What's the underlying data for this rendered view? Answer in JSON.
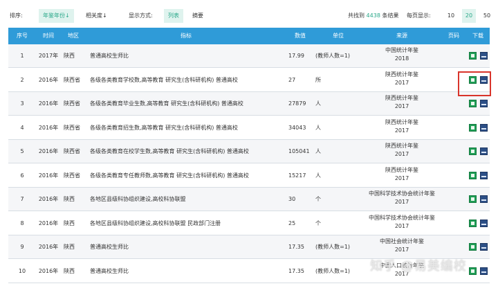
{
  "toolbar": {
    "sort_label": "排序:",
    "sort_year": "年鉴年份↓",
    "sort_relevance": "相关度↓",
    "display_label": "显示方式:",
    "view_list": "列表",
    "view_summary": "摘要",
    "found_prefix": "共找到",
    "found_count": "4438",
    "found_suffix": "条结果",
    "per_page_label": "每页显示:",
    "page_sizes": [
      "10",
      "20",
      "50"
    ],
    "selected_page_size": "20"
  },
  "table": {
    "headers": [
      "序号",
      "时间",
      "地区",
      "指标",
      "数值",
      "单位",
      "来源",
      "页码",
      "下载"
    ],
    "rows": [
      {
        "no": "1",
        "time": "2017年",
        "region": "陕西",
        "indicator": "普通高校生师比",
        "value": "17.99",
        "unit": "(教师人数=1)",
        "source": "中国统计年鉴",
        "source_year": "2018"
      },
      {
        "no": "2",
        "time": "2016年",
        "region": "陕西省",
        "indicator": "各级各类教育学校数,高等教育 研究生(含科研机构) 普通高校",
        "value": "27",
        "unit": "所",
        "source": "陕西统计年鉴",
        "source_year": "2017"
      },
      {
        "no": "3",
        "time": "2016年",
        "region": "陕西省",
        "indicator": "各级各类教育毕业生数,高等教育 研究生(含科研机构) 普通高校",
        "value": "27879",
        "unit": "人",
        "source": "陕西统计年鉴",
        "source_year": "2017"
      },
      {
        "no": "4",
        "time": "2016年",
        "region": "陕西省",
        "indicator": "各级各类教育招生数,高等教育 研究生(含科研机构) 普通高校",
        "value": "34043",
        "unit": "人",
        "source": "陕西统计年鉴",
        "source_year": "2017"
      },
      {
        "no": "5",
        "time": "2016年",
        "region": "陕西省",
        "indicator": "各级各类教育在校学生数,高等教育 研究生(含科研机构) 普通高校",
        "value": "105041",
        "unit": "人",
        "source": "陕西统计年鉴",
        "source_year": "2017"
      },
      {
        "no": "6",
        "time": "2016年",
        "region": "陕西省",
        "indicator": "各级各类教育专任教师数,高等教育 研究生(含科研机构) 普通高校",
        "value": "15217",
        "unit": "人",
        "source": "陕西统计年鉴",
        "source_year": "2017"
      },
      {
        "no": "7",
        "time": "2016年",
        "region": "陕西",
        "indicator": "各地区县级科协组织建设,高校科协联盟",
        "value": "30",
        "unit": "个",
        "source": "中国科学技术协会统计年鉴",
        "source_year": "2017"
      },
      {
        "no": "8",
        "time": "2016年",
        "region": "陕西",
        "indicator": "各地区县级科协组织建设,高校科协联盟 民政部门注册",
        "value": "25",
        "unit": "个",
        "source": "中国科学技术协会统计年鉴",
        "source_year": "2017"
      },
      {
        "no": "9",
        "time": "2016年",
        "region": "陕西",
        "indicator": "普通高校生师比",
        "value": "17.35",
        "unit": "(教师人数=1)",
        "source": "中国社会统计年鉴",
        "source_year": "2017"
      },
      {
        "no": "10",
        "time": "2016年",
        "region": "陕西",
        "indicator": "普通高校生师比",
        "value": "17.35",
        "unit": "(教师人数=1)",
        "source": "中国人口统计年鉴",
        "source_year": "2017"
      }
    ]
  },
  "icons": {
    "excel": "excel-file-icon",
    "caj": "caj-file-icon"
  },
  "colors": {
    "header_bg": "#2f9bd8",
    "accent": "#2aa88a",
    "highlight_box": "#d9342b"
  },
  "watermark": "知乎 @易美编校"
}
